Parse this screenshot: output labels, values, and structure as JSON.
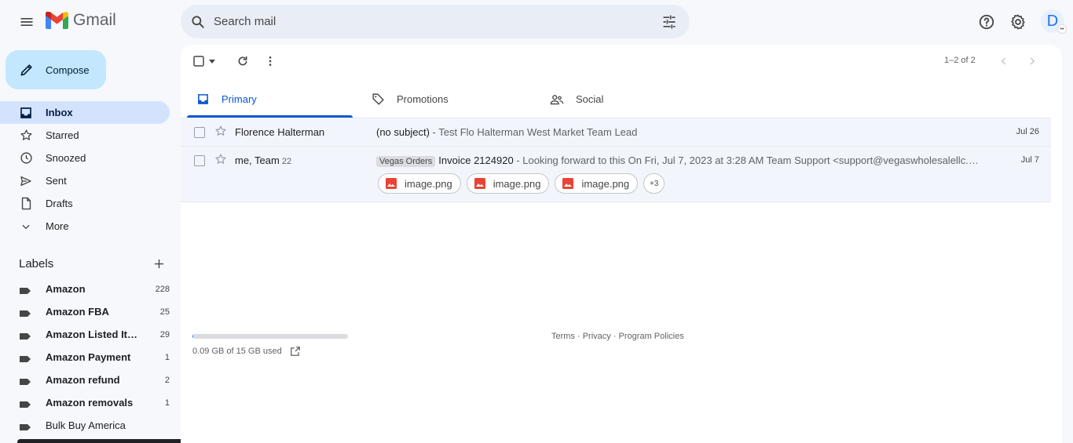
{
  "app": {
    "name": "Gmail"
  },
  "search": {
    "placeholder": "Search mail"
  },
  "compose": {
    "label": "Compose"
  },
  "nav": [
    {
      "label": "Inbox",
      "icon": "inbox-icon",
      "active": true
    },
    {
      "label": "Starred",
      "icon": "star-icon"
    },
    {
      "label": "Snoozed",
      "icon": "clock-icon"
    },
    {
      "label": "Sent",
      "icon": "send-icon"
    },
    {
      "label": "Drafts",
      "icon": "draft-icon"
    },
    {
      "label": "More",
      "icon": "chevron-down-icon"
    }
  ],
  "labels": {
    "title": "Labels",
    "items": [
      {
        "name": "Amazon",
        "count": "228"
      },
      {
        "name": "Amazon FBA",
        "count": "25"
      },
      {
        "name": "Amazon Listed Items",
        "count": "29"
      },
      {
        "name": "Amazon Payment",
        "count": "1"
      },
      {
        "name": "Amazon refund",
        "count": "2"
      },
      {
        "name": "Amazon removals",
        "count": "1"
      },
      {
        "name": "Bulk Buy America",
        "count": ""
      }
    ]
  },
  "user": {
    "avatar_letter": "D"
  },
  "toolbar": {
    "pager": "1–2 of 2"
  },
  "tabs": [
    {
      "label": "Primary",
      "icon": "inbox-icon",
      "active": true
    },
    {
      "label": "Promotions",
      "icon": "tag-icon"
    },
    {
      "label": "Social",
      "icon": "people-icon"
    }
  ],
  "emails": [
    {
      "sender": "Florence Halterman",
      "sender_count": "",
      "subject": "(no subject)",
      "snippet": " - Test Flo Halterman West Market Team Lead",
      "date": "Jul 26"
    },
    {
      "sender": "me, Team",
      "sender_count": "22",
      "tag": "Vegas Orders",
      "subject": "Invoice 2124920",
      "snippet": " - Looking forward to this On Fri, Jul 7, 2023 at 3:28 AM Team Support <support@vegaswholesalellc.com> wrote:",
      "date": "Jul 7",
      "attachments": [
        "image.png",
        "image.png",
        "image.png"
      ],
      "more_attachments": "+3"
    }
  ],
  "footer": {
    "links": "Terms · Privacy · Program Policies"
  },
  "storage": {
    "text": "0.09 GB of 15 GB used",
    "used_fraction": 0.006
  },
  "colors": {
    "accent": "#0b57d0",
    "compose_bg": "#c2e7ff",
    "active_nav": "#d3e3fd"
  }
}
